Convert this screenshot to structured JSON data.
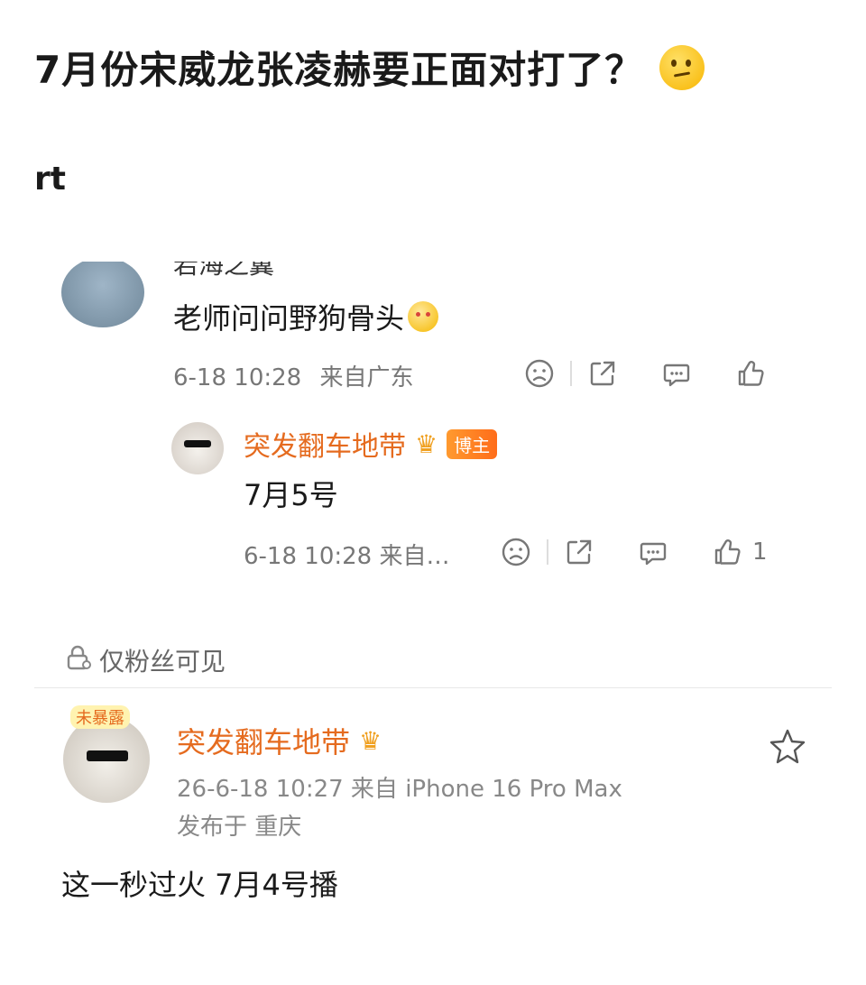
{
  "post": {
    "title": "7月份宋威龙张凌赫要正面对打了？",
    "subtitle": "rt"
  },
  "comment": {
    "user_name_cut": "若海之翼",
    "text": "老师问问野狗骨头",
    "time": "6-18 10:28",
    "location": "来自广东"
  },
  "reply": {
    "user_name": "突发翻车地带",
    "badge": "博主",
    "text": "7月5号",
    "meta": "6-18 10:28  来自…",
    "like_count": "1"
  },
  "visibility": {
    "label": "仅粉丝可见"
  },
  "original": {
    "avatar_tag": "未暴露",
    "user_name": "突发翻车地带",
    "meta_line1": "26-6-18 10:27   来自 iPhone 16 Pro Max",
    "meta_line2": "发布于 重庆",
    "body": "这一秒过火 7月4号播"
  },
  "icons": [
    "thinking-emoji",
    "hug-emoji",
    "dislike-icon",
    "share-icon",
    "comment-icon",
    "like-icon",
    "crown-icon",
    "lock-icon",
    "star-icon"
  ],
  "colors": {
    "name_accent": "#e56b1f",
    "meta_gray": "#777777",
    "badge_orange": "#ff7a1f"
  }
}
